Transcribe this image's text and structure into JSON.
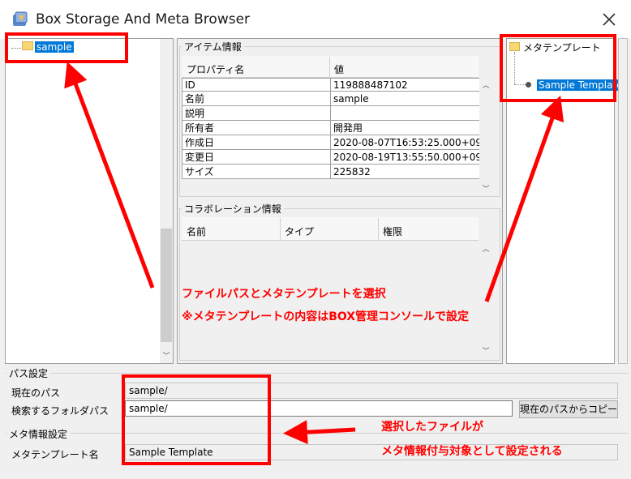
{
  "window": {
    "title": "Box Storage And Meta Browser"
  },
  "folder_tree": {
    "items": [
      {
        "label": "sample"
      }
    ]
  },
  "item_info": {
    "group_title": "アイテム情報",
    "columns": {
      "property": "プロパティ名",
      "value": "値"
    },
    "rows": [
      {
        "name": "ID",
        "value": "119888487102"
      },
      {
        "name": "名前",
        "value": "sample"
      },
      {
        "name": "説明",
        "value": ""
      },
      {
        "name": "所有者",
        "value": "開発用"
      },
      {
        "name": "作成日",
        "value": "2020-08-07T16:53:25.000+09:..."
      },
      {
        "name": "変更日",
        "value": "2020-08-19T13:55:50.000+09:..."
      },
      {
        "name": "サイズ",
        "value": "225832"
      }
    ]
  },
  "collab_info": {
    "group_title": "コラボレーション情報",
    "columns": {
      "name": "名前",
      "type": "タイプ",
      "permission": "権限"
    }
  },
  "meta_tree": {
    "root_label": "メタテンプレート",
    "items": [
      {
        "label": "Sample Template"
      }
    ]
  },
  "path_settings": {
    "group_title": "パス設定",
    "current_path_label": "現在のパス",
    "current_path_value": "sample/",
    "search_folder_label": "検索するフォルダパス",
    "search_folder_value": "sample/",
    "copy_button_label": "現在のパスからコピー"
  },
  "meta_settings": {
    "group_title": "メタ情報設定",
    "template_name_label": "メタテンプレート名",
    "template_name_value": "Sample Template"
  },
  "annotations": {
    "note1": "ファイルパスとメタテンプレートを選択",
    "note2": "※メタテンプレートの内容はBOX管理コンソールで設定",
    "note3": "選択したファイルが",
    "note4": "メタ情報付与対象として設定される"
  },
  "colors": {
    "annotation": "#ff0000",
    "selection": "#0078d7"
  }
}
